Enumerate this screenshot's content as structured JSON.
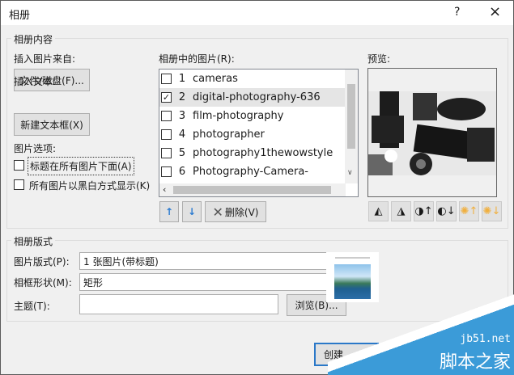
{
  "title": "相册",
  "title_buttons": {
    "help": "?",
    "close": "×"
  },
  "content_group": {
    "label": "相册内容",
    "insert_from_label": "插入图片来自:",
    "file_disk_button": "文件/磁盘(F)...",
    "insert_text_label": "插入文本:",
    "new_textbox_button": "新建文本框(X)",
    "picture_options_label": "图片选项:",
    "options": [
      {
        "label": "标题在所有图片下面(A)",
        "checked": false
      },
      {
        "label": "所有图片以黑白方式显示(K)",
        "checked": false
      }
    ],
    "pictures_label": "相册中的图片(R):",
    "pictures": [
      {
        "num": "1",
        "name": "cameras",
        "checked": false
      },
      {
        "num": "2",
        "name": "digital-photography-636",
        "checked": true
      },
      {
        "num": "3",
        "name": "film-photography",
        "checked": false
      },
      {
        "num": "4",
        "name": "photographer",
        "checked": false
      },
      {
        "num": "5",
        "name": "photography1thewowstyle",
        "checked": false
      },
      {
        "num": "6",
        "name": "Photography-Camera-",
        "checked": false
      }
    ],
    "move_up": "↑",
    "move_down": "↓",
    "delete_button": "删除(V)",
    "preview_label": "预览:"
  },
  "layout_group": {
    "label": "相册版式",
    "picture_layout_label": "图片版式(P):",
    "picture_layout_value": "1 张图片(带标题)",
    "frame_shape_label": "相框形状(M):",
    "frame_shape_value": "矩形",
    "theme_label": "主题(T):",
    "theme_value": "",
    "browse_button": "浏览(B)..."
  },
  "create_button": "创建",
  "watermark": {
    "site": "jb51.net",
    "name": "脚本之家"
  }
}
